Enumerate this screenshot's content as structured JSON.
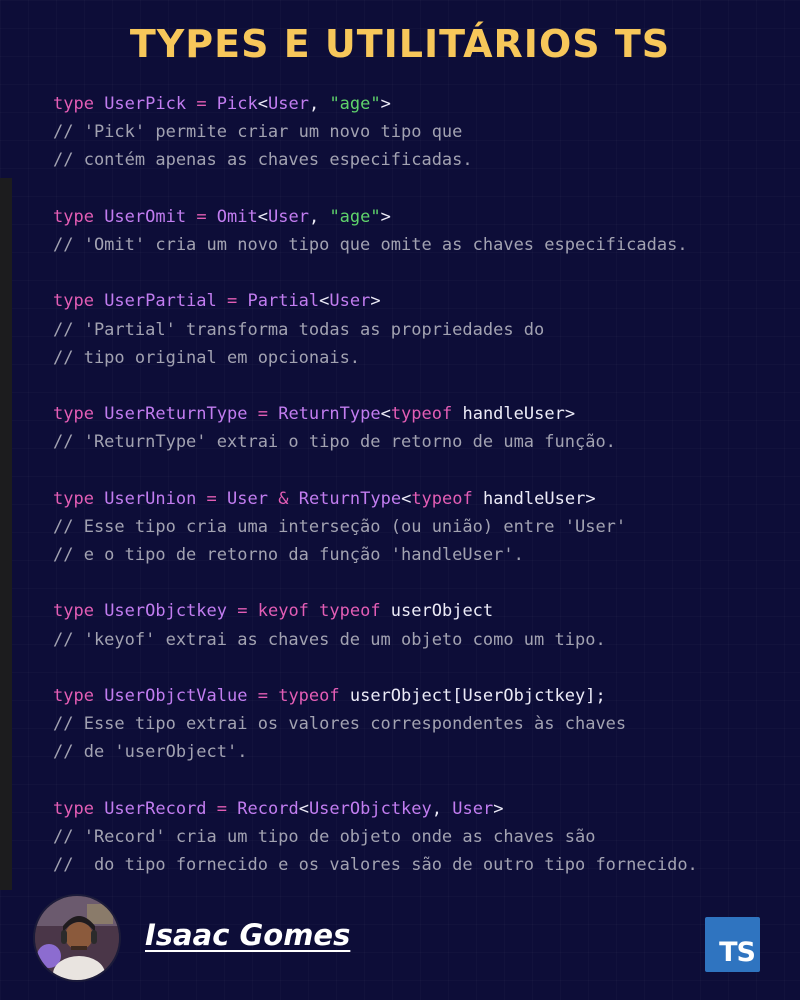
{
  "title": "TYPES E UTILITÁRIOS TS",
  "code": {
    "lines": [
      [
        {
          "t": "type ",
          "c": "kw"
        },
        {
          "t": "UserPick",
          "c": "ty"
        },
        {
          "t": " = ",
          "c": "kw"
        },
        {
          "t": "Pick",
          "c": "ty"
        },
        {
          "t": "<",
          "c": "pl"
        },
        {
          "t": "User",
          "c": "ty"
        },
        {
          "t": ", ",
          "c": "pl"
        },
        {
          "t": "\"age\"",
          "c": "st"
        },
        {
          "t": ">",
          "c": "pl"
        }
      ],
      [
        {
          "t": "// 'Pick' permite criar um novo tipo que",
          "c": "cm"
        }
      ],
      [
        {
          "t": "// contém apenas as chaves especificadas.",
          "c": "cm"
        }
      ],
      [],
      [
        {
          "t": "type ",
          "c": "kw"
        },
        {
          "t": "UserOmit",
          "c": "ty"
        },
        {
          "t": " = ",
          "c": "kw"
        },
        {
          "t": "Omit",
          "c": "ty"
        },
        {
          "t": "<",
          "c": "pl"
        },
        {
          "t": "User",
          "c": "ty"
        },
        {
          "t": ", ",
          "c": "pl"
        },
        {
          "t": "\"age\"",
          "c": "st"
        },
        {
          "t": ">",
          "c": "pl"
        }
      ],
      [
        {
          "t": "// 'Omit' cria um novo tipo que omite as chaves especificadas.",
          "c": "cm"
        }
      ],
      [],
      [
        {
          "t": "type ",
          "c": "kw"
        },
        {
          "t": "UserPartial",
          "c": "ty"
        },
        {
          "t": " = ",
          "c": "kw"
        },
        {
          "t": "Partial",
          "c": "ty"
        },
        {
          "t": "<",
          "c": "pl"
        },
        {
          "t": "User",
          "c": "ty"
        },
        {
          "t": ">",
          "c": "pl"
        }
      ],
      [
        {
          "t": "// 'Partial' transforma todas as propriedades do",
          "c": "cm"
        }
      ],
      [
        {
          "t": "// tipo original em opcionais.",
          "c": "cm"
        }
      ],
      [],
      [
        {
          "t": "type ",
          "c": "kw"
        },
        {
          "t": "UserReturnType",
          "c": "ty"
        },
        {
          "t": " = ",
          "c": "kw"
        },
        {
          "t": "ReturnType",
          "c": "ty"
        },
        {
          "t": "<",
          "c": "pl"
        },
        {
          "t": "typeof",
          "c": "kw"
        },
        {
          "t": " handleUser>",
          "c": "pl"
        }
      ],
      [
        {
          "t": "// 'ReturnType' extrai o tipo de retorno de uma função.",
          "c": "cm"
        }
      ],
      [],
      [
        {
          "t": "type ",
          "c": "kw"
        },
        {
          "t": "UserUnion",
          "c": "ty"
        },
        {
          "t": " = ",
          "c": "kw"
        },
        {
          "t": "User",
          "c": "ty"
        },
        {
          "t": " & ",
          "c": "kw"
        },
        {
          "t": "ReturnType",
          "c": "ty"
        },
        {
          "t": "<",
          "c": "pl"
        },
        {
          "t": "typeof",
          "c": "kw"
        },
        {
          "t": " handleUser>",
          "c": "pl"
        }
      ],
      [
        {
          "t": "// Esse tipo cria uma interseção (ou união) entre 'User'",
          "c": "cm"
        }
      ],
      [
        {
          "t": "// e o tipo de retorno da função 'handleUser'.",
          "c": "cm"
        }
      ],
      [],
      [
        {
          "t": "type ",
          "c": "kw"
        },
        {
          "t": "UserObjctkey",
          "c": "ty"
        },
        {
          "t": " = ",
          "c": "kw"
        },
        {
          "t": "keyof typeof",
          "c": "kw"
        },
        {
          "t": " userObject",
          "c": "pl"
        }
      ],
      [
        {
          "t": "// 'keyof' extrai as chaves de um objeto como um tipo.",
          "c": "cm"
        }
      ],
      [],
      [
        {
          "t": "type ",
          "c": "kw"
        },
        {
          "t": "UserObjctValue",
          "c": "ty"
        },
        {
          "t": " = ",
          "c": "kw"
        },
        {
          "t": "typeof",
          "c": "kw"
        },
        {
          "t": " userObject[UserObjctkey];",
          "c": "pl"
        }
      ],
      [
        {
          "t": "// Esse tipo extrai os valores correspondentes às chaves",
          "c": "cm"
        }
      ],
      [
        {
          "t": "// de 'userObject'.",
          "c": "cm"
        }
      ],
      [],
      [
        {
          "t": "type ",
          "c": "kw"
        },
        {
          "t": "UserRecord",
          "c": "ty"
        },
        {
          "t": " = ",
          "c": "kw"
        },
        {
          "t": "Record",
          "c": "ty"
        },
        {
          "t": "<",
          "c": "pl"
        },
        {
          "t": "UserObjctkey",
          "c": "ty"
        },
        {
          "t": ", ",
          "c": "pl"
        },
        {
          "t": "User",
          "c": "ty"
        },
        {
          "t": ">",
          "c": "pl"
        }
      ],
      [
        {
          "t": "// 'Record' cria um tipo de objeto onde as chaves são",
          "c": "cm"
        }
      ],
      [
        {
          "t": "//  do tipo fornecido e os valores são de outro tipo fornecido.",
          "c": "cm"
        }
      ]
    ]
  },
  "footer": {
    "author": "Isaac Gomes",
    "badge": "TS",
    "avatar_icon": "avatar-icon"
  },
  "colors": {
    "background": "#0d0d38",
    "title": "#f7c75a",
    "keyword": "#e35db5",
    "type": "#c27df0",
    "string": "#5fd36b",
    "plain": "#ecebf7",
    "comment": "#a2a2b1",
    "ts_badge": "#2f74c0"
  }
}
